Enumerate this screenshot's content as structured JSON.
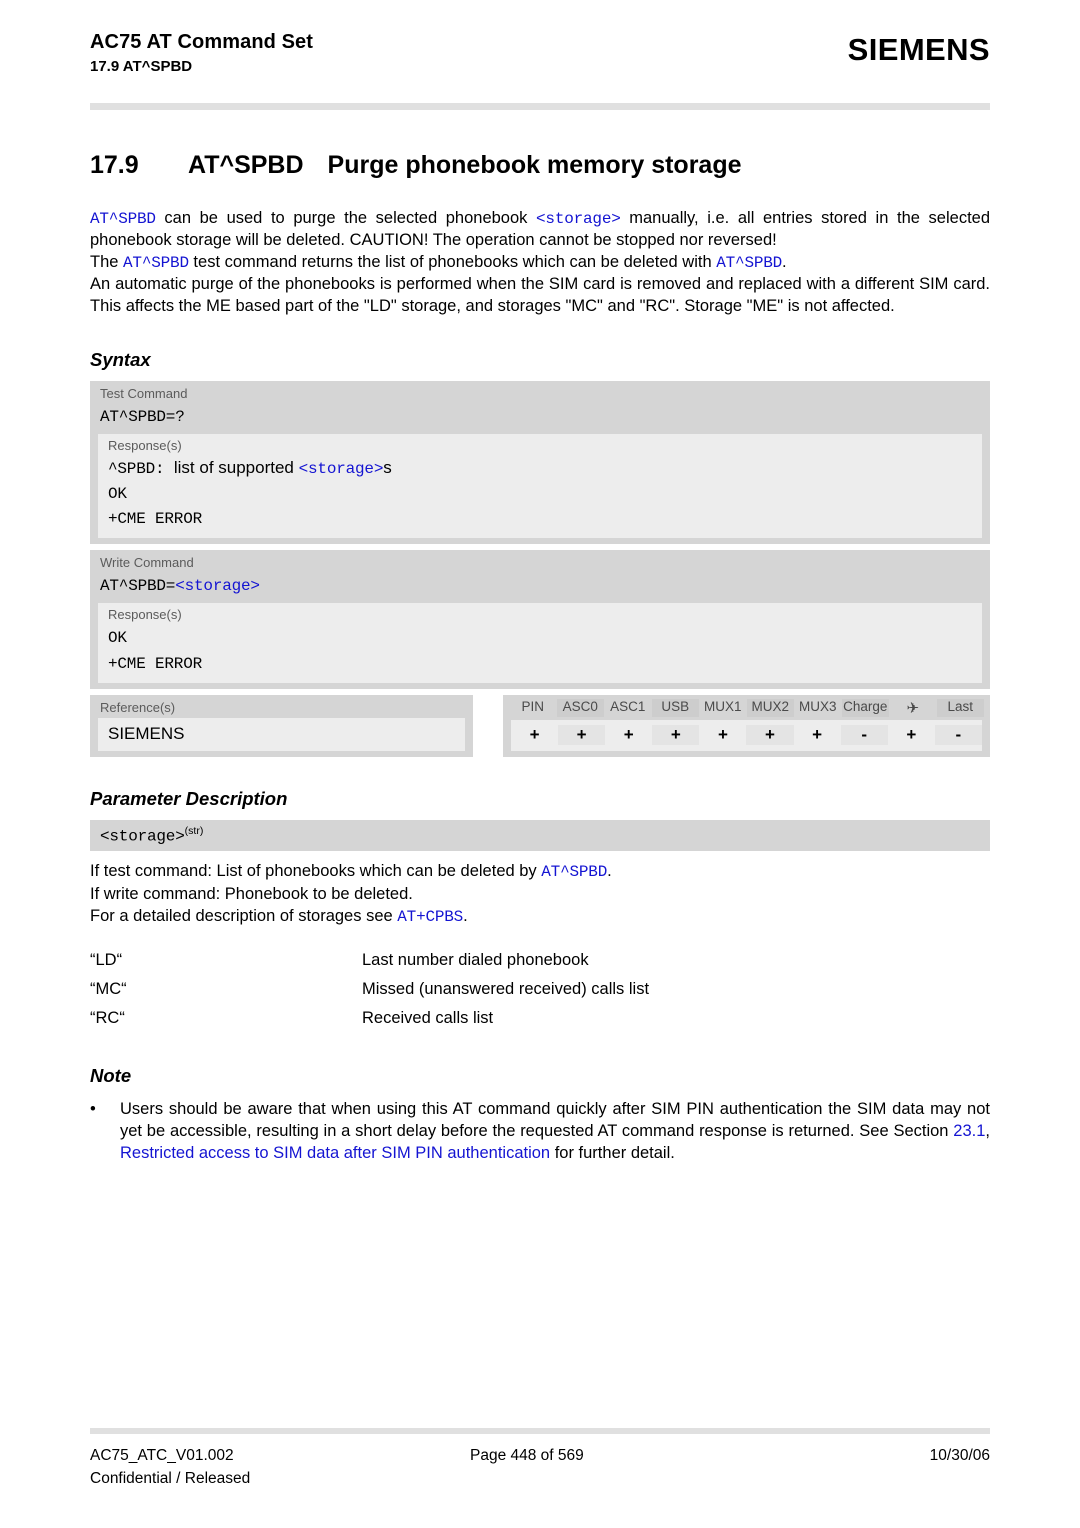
{
  "header": {
    "doc_title": "AC75 AT Command Set",
    "doc_subtitle": "17.9 AT^SPBD",
    "brand": "SIEMENS"
  },
  "section": {
    "number": "17.9",
    "command": "AT^SPBD",
    "title": "Purge phonebook memory storage"
  },
  "intro": {
    "p1_cmd": "AT^SPBD",
    "p1_a": " can be used to purge the selected phonebook ",
    "p1_param": "<storage>",
    "p1_b": " manually, i.e. all entries stored in the selected phonebook storage will be deleted. CAUTION! The operation cannot be stopped nor reversed!",
    "p2_a": "The ",
    "p2_cmd": "AT^SPBD",
    "p2_b": " test command returns the list of phonebooks which can be deleted with ",
    "p2_cmd2": "AT^SPBD",
    "p2_c": ".",
    "p3": "An automatic purge of the phonebooks is performed when the SIM card is removed and replaced with a different SIM card. This affects the ME based part of the \"LD\" storage, and storages \"MC\" and \"RC\". Storage \"ME\" is not affected."
  },
  "syntax": {
    "heading": "Syntax",
    "test": {
      "label": "Test Command",
      "command": "AT^SPBD=?",
      "response_label": "Response(s)",
      "resp_prefix": "^SPBD:",
      "resp_text": "list of supported ",
      "resp_param": "<storage>",
      "resp_suffix": "s",
      "resp_ok": "OK",
      "resp_err": "+CME ERROR"
    },
    "write": {
      "label": "Write Command",
      "command_prefix": "AT^SPBD=",
      "command_param": "<storage>",
      "response_label": "Response(s)",
      "resp_ok": "OK",
      "resp_err": "+CME ERROR"
    },
    "reference": {
      "label": "Reference(s)",
      "value": "SIEMENS"
    },
    "compat": {
      "headers": [
        "PIN",
        "ASC0",
        "ASC1",
        "USB",
        "MUX1",
        "MUX2",
        "MUX3",
        "Charge",
        "✈",
        "Last"
      ],
      "values": [
        "+",
        "+",
        "+",
        "+",
        "+",
        "+",
        "+",
        "-",
        "+",
        "-"
      ]
    }
  },
  "parameter_description": {
    "heading": "Parameter Description",
    "param_name": "<storage>",
    "param_type": "(str)",
    "line1_a": "If test command: List of phonebooks which can be deleted by ",
    "line1_cmd": "AT^SPBD",
    "line1_b": ".",
    "line2": "If write command: Phonebook to be deleted.",
    "line3_a": "For a detailed description of storages see ",
    "line3_cmd": "AT+CPBS",
    "line3_b": ".",
    "values": [
      {
        "key": "“LD“",
        "desc": "Last number dialed phonebook"
      },
      {
        "key": "“MC“",
        "desc": "Missed (unanswered received) calls list"
      },
      {
        "key": "“RC“",
        "desc": "Received calls list"
      }
    ]
  },
  "note": {
    "heading": "Note",
    "bullet": "•",
    "text_a": "Users should be aware that when using this AT command quickly after SIM PIN authentication the SIM data may not yet be accessible, resulting in a short delay before the requested AT command response is returned. See Section ",
    "link_num": "23.1",
    "link_sep": ", ",
    "link_text": "Restricted access to SIM data after SIM PIN authentication",
    "text_b": " for further detail."
  },
  "footer": {
    "doc_id": "AC75_ATC_V01.002",
    "page": "Page 448 of 569",
    "date": "10/30/06",
    "classification": "Confidential / Released"
  },
  "colors": {
    "link_blue": "#1414d2",
    "band_gray": "#d5d5d5",
    "panel_gray": "#ededed",
    "rule_gray": "#e0e0e0"
  }
}
